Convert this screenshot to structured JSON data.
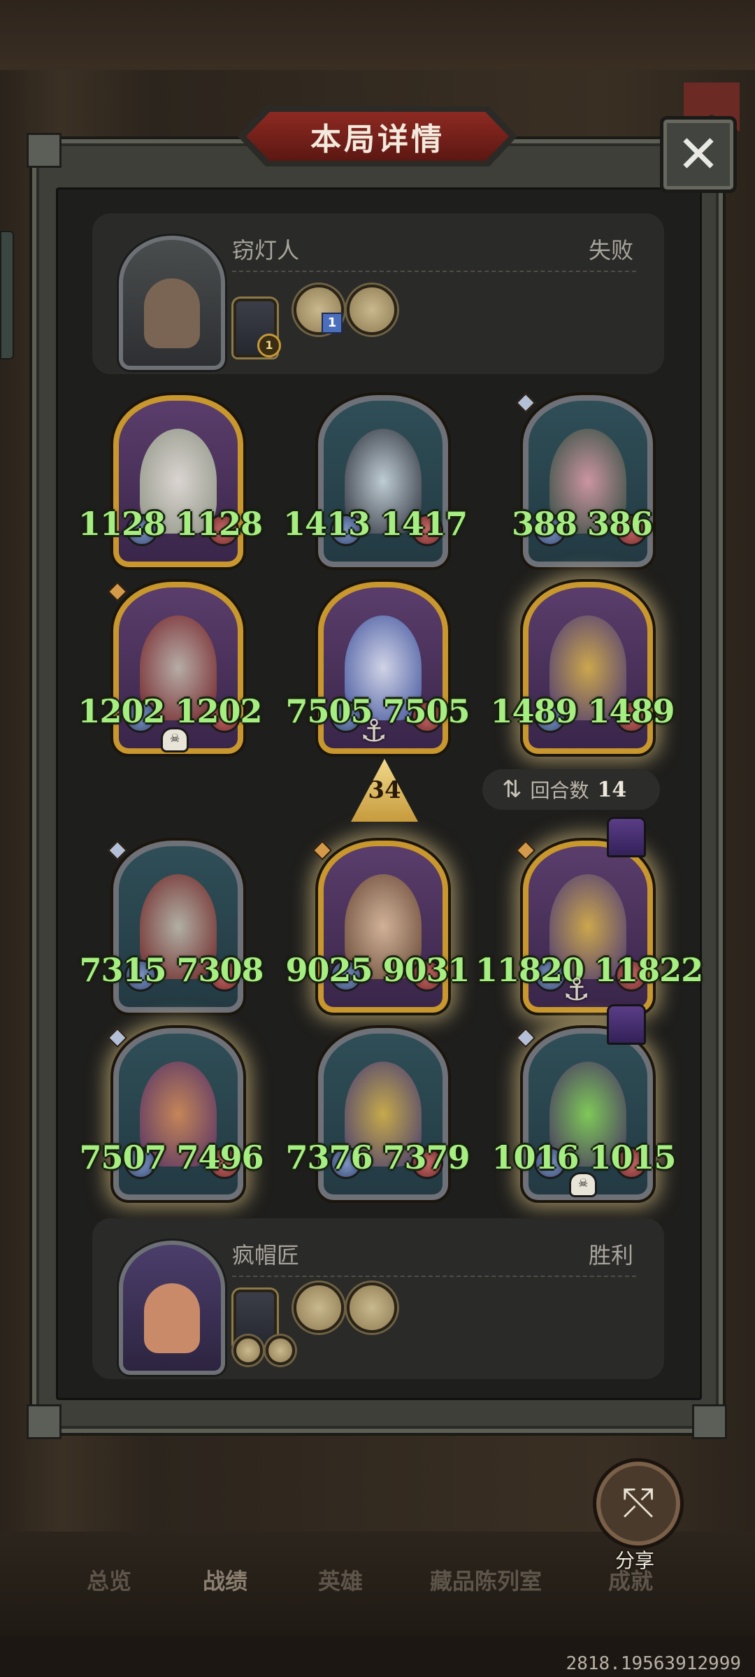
{
  "title": "本局详情",
  "close_label": "✕",
  "top_player": {
    "name": "窃灯人",
    "result": "失败",
    "items": [
      {
        "icon": "robot-hero-power-icon",
        "badge": "1"
      },
      {
        "icon": "scroll-trinket-icon",
        "badge": "1"
      },
      {
        "icon": "scroll-trinket-icon",
        "badge": ""
      }
    ]
  },
  "bottom_player": {
    "name": "疯帽匠",
    "result": "胜利",
    "items": [
      {
        "icon": "hero-power-icon"
      },
      {
        "icon": "gift-box-icon"
      },
      {
        "icon": "blade-trinket-icon"
      }
    ],
    "small_items": [
      {
        "icon": "sword-icon"
      },
      {
        "icon": "claw-icon"
      }
    ]
  },
  "top_board": [
    {
      "name": "flower-minion",
      "attack": "1128",
      "health": "1128"
    },
    {
      "name": "queen-minion",
      "attack": "1413",
      "health": "1417"
    },
    {
      "name": "dryad-minion",
      "attack": "388",
      "health": "386"
    },
    {
      "name": "hooded-assassin-minion",
      "attack": "1202",
      "health": "1202"
    },
    {
      "name": "ice-princess-minion",
      "attack": "7505",
      "health": "7505"
    },
    {
      "name": "golden-golem-minion",
      "attack": "1489",
      "health": "1489"
    }
  ],
  "bottom_board": [
    {
      "name": "hooded-assassin-minion",
      "attack": "7315",
      "health": "7308"
    },
    {
      "name": "detective-minion",
      "attack": "9025",
      "health": "9031"
    },
    {
      "name": "golden-golem-minion",
      "attack": "11820",
      "health": "11822"
    },
    {
      "name": "archer-minion",
      "attack": "7507",
      "health": "7496"
    },
    {
      "name": "golden-golem-minion",
      "attack": "7376",
      "health": "7379"
    },
    {
      "name": "caterpillar-minion",
      "attack": "1016",
      "health": "1015"
    }
  ],
  "attack_indicator": "34",
  "rounds": {
    "label": "回合数",
    "value": "14"
  },
  "share_label": "分享",
  "nav": [
    "总览",
    "战绩",
    "英雄",
    "藏品陈列室",
    "成就"
  ],
  "footer_id": "2818.19563912999",
  "colors": {
    "stat_green": "#a7ee82",
    "title_red": "#8d2a22"
  }
}
